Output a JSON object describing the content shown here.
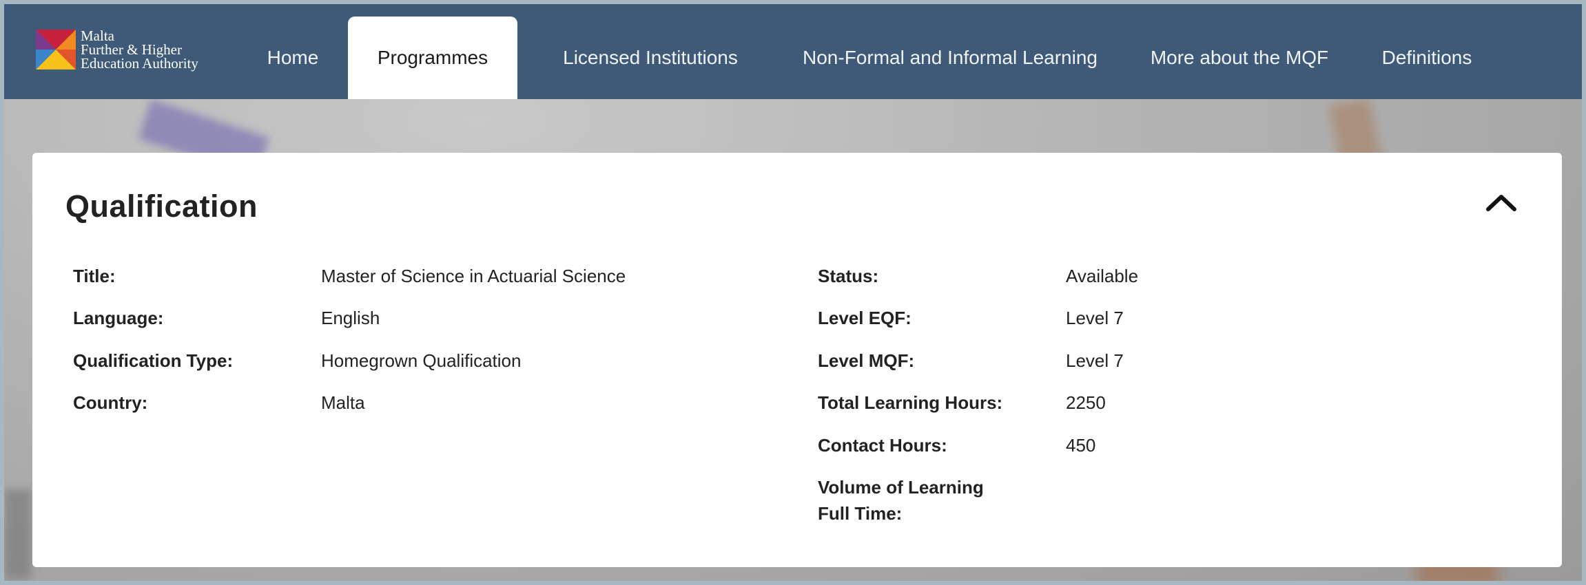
{
  "logo": {
    "lines": [
      "Malta",
      "Further & Higher",
      "Education Authority"
    ]
  },
  "nav": {
    "items": [
      {
        "label": "Home",
        "active": false
      },
      {
        "label": "Programmes",
        "active": true
      },
      {
        "label": "Licensed Institutions",
        "active": false
      },
      {
        "label": "Non-Formal and Informal Learning",
        "active": false
      },
      {
        "label": "More about the MQF",
        "active": false
      },
      {
        "label": "Definitions",
        "active": false
      }
    ]
  },
  "card": {
    "title": "Qualification",
    "collapse_icon": "chevron-up-icon",
    "left_fields": [
      {
        "label": "Title:",
        "value": "Master of Science in Actuarial Science"
      },
      {
        "label": "Language:",
        "value": "English"
      },
      {
        "label": "Qualification Type:",
        "value": "Homegrown Qualification"
      },
      {
        "label": "Country:",
        "value": "Malta"
      }
    ],
    "right_fields": [
      {
        "label": "Status:",
        "value": "Available"
      },
      {
        "label": "Level EQF:",
        "value": "Level 7"
      },
      {
        "label": "Level MQF:",
        "value": "Level 7"
      },
      {
        "label": "Total Learning Hours:",
        "value": "2250"
      },
      {
        "label": "Contact Hours:",
        "value": "450"
      },
      {
        "label": "Volume of Learning Full Time:",
        "value": ""
      }
    ]
  },
  "colors": {
    "navbar": "#3e5a78",
    "card": "#ffffff",
    "text": "#222222"
  }
}
